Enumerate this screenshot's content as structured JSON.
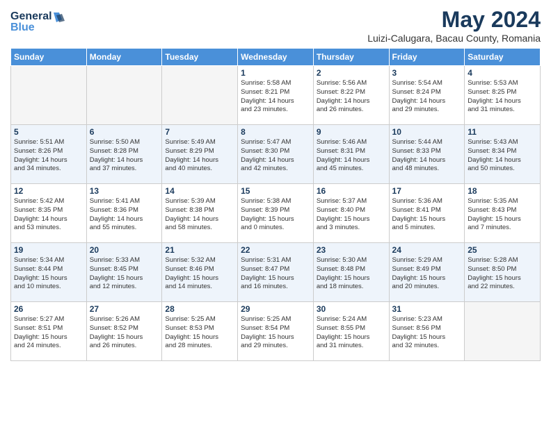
{
  "logo": {
    "line1": "General",
    "line2": "Blue"
  },
  "title": "May 2024",
  "subtitle": "Luizi-Calugara, Bacau County, Romania",
  "weekdays": [
    "Sunday",
    "Monday",
    "Tuesday",
    "Wednesday",
    "Thursday",
    "Friday",
    "Saturday"
  ],
  "weeks": [
    [
      {
        "day": "",
        "info": ""
      },
      {
        "day": "",
        "info": ""
      },
      {
        "day": "",
        "info": ""
      },
      {
        "day": "1",
        "info": "Sunrise: 5:58 AM\nSunset: 8:21 PM\nDaylight: 14 hours\nand 23 minutes."
      },
      {
        "day": "2",
        "info": "Sunrise: 5:56 AM\nSunset: 8:22 PM\nDaylight: 14 hours\nand 26 minutes."
      },
      {
        "day": "3",
        "info": "Sunrise: 5:54 AM\nSunset: 8:24 PM\nDaylight: 14 hours\nand 29 minutes."
      },
      {
        "day": "4",
        "info": "Sunrise: 5:53 AM\nSunset: 8:25 PM\nDaylight: 14 hours\nand 31 minutes."
      }
    ],
    [
      {
        "day": "5",
        "info": "Sunrise: 5:51 AM\nSunset: 8:26 PM\nDaylight: 14 hours\nand 34 minutes."
      },
      {
        "day": "6",
        "info": "Sunrise: 5:50 AM\nSunset: 8:28 PM\nDaylight: 14 hours\nand 37 minutes."
      },
      {
        "day": "7",
        "info": "Sunrise: 5:49 AM\nSunset: 8:29 PM\nDaylight: 14 hours\nand 40 minutes."
      },
      {
        "day": "8",
        "info": "Sunrise: 5:47 AM\nSunset: 8:30 PM\nDaylight: 14 hours\nand 42 minutes."
      },
      {
        "day": "9",
        "info": "Sunrise: 5:46 AM\nSunset: 8:31 PM\nDaylight: 14 hours\nand 45 minutes."
      },
      {
        "day": "10",
        "info": "Sunrise: 5:44 AM\nSunset: 8:33 PM\nDaylight: 14 hours\nand 48 minutes."
      },
      {
        "day": "11",
        "info": "Sunrise: 5:43 AM\nSunset: 8:34 PM\nDaylight: 14 hours\nand 50 minutes."
      }
    ],
    [
      {
        "day": "12",
        "info": "Sunrise: 5:42 AM\nSunset: 8:35 PM\nDaylight: 14 hours\nand 53 minutes."
      },
      {
        "day": "13",
        "info": "Sunrise: 5:41 AM\nSunset: 8:36 PM\nDaylight: 14 hours\nand 55 minutes."
      },
      {
        "day": "14",
        "info": "Sunrise: 5:39 AM\nSunset: 8:38 PM\nDaylight: 14 hours\nand 58 minutes."
      },
      {
        "day": "15",
        "info": "Sunrise: 5:38 AM\nSunset: 8:39 PM\nDaylight: 15 hours\nand 0 minutes."
      },
      {
        "day": "16",
        "info": "Sunrise: 5:37 AM\nSunset: 8:40 PM\nDaylight: 15 hours\nand 3 minutes."
      },
      {
        "day": "17",
        "info": "Sunrise: 5:36 AM\nSunset: 8:41 PM\nDaylight: 15 hours\nand 5 minutes."
      },
      {
        "day": "18",
        "info": "Sunrise: 5:35 AM\nSunset: 8:43 PM\nDaylight: 15 hours\nand 7 minutes."
      }
    ],
    [
      {
        "day": "19",
        "info": "Sunrise: 5:34 AM\nSunset: 8:44 PM\nDaylight: 15 hours\nand 10 minutes."
      },
      {
        "day": "20",
        "info": "Sunrise: 5:33 AM\nSunset: 8:45 PM\nDaylight: 15 hours\nand 12 minutes."
      },
      {
        "day": "21",
        "info": "Sunrise: 5:32 AM\nSunset: 8:46 PM\nDaylight: 15 hours\nand 14 minutes."
      },
      {
        "day": "22",
        "info": "Sunrise: 5:31 AM\nSunset: 8:47 PM\nDaylight: 15 hours\nand 16 minutes."
      },
      {
        "day": "23",
        "info": "Sunrise: 5:30 AM\nSunset: 8:48 PM\nDaylight: 15 hours\nand 18 minutes."
      },
      {
        "day": "24",
        "info": "Sunrise: 5:29 AM\nSunset: 8:49 PM\nDaylight: 15 hours\nand 20 minutes."
      },
      {
        "day": "25",
        "info": "Sunrise: 5:28 AM\nSunset: 8:50 PM\nDaylight: 15 hours\nand 22 minutes."
      }
    ],
    [
      {
        "day": "26",
        "info": "Sunrise: 5:27 AM\nSunset: 8:51 PM\nDaylight: 15 hours\nand 24 minutes."
      },
      {
        "day": "27",
        "info": "Sunrise: 5:26 AM\nSunset: 8:52 PM\nDaylight: 15 hours\nand 26 minutes."
      },
      {
        "day": "28",
        "info": "Sunrise: 5:25 AM\nSunset: 8:53 PM\nDaylight: 15 hours\nand 28 minutes."
      },
      {
        "day": "29",
        "info": "Sunrise: 5:25 AM\nSunset: 8:54 PM\nDaylight: 15 hours\nand 29 minutes."
      },
      {
        "day": "30",
        "info": "Sunrise: 5:24 AM\nSunset: 8:55 PM\nDaylight: 15 hours\nand 31 minutes."
      },
      {
        "day": "31",
        "info": "Sunrise: 5:23 AM\nSunset: 8:56 PM\nDaylight: 15 hours\nand 32 minutes."
      },
      {
        "day": "",
        "info": ""
      }
    ]
  ]
}
